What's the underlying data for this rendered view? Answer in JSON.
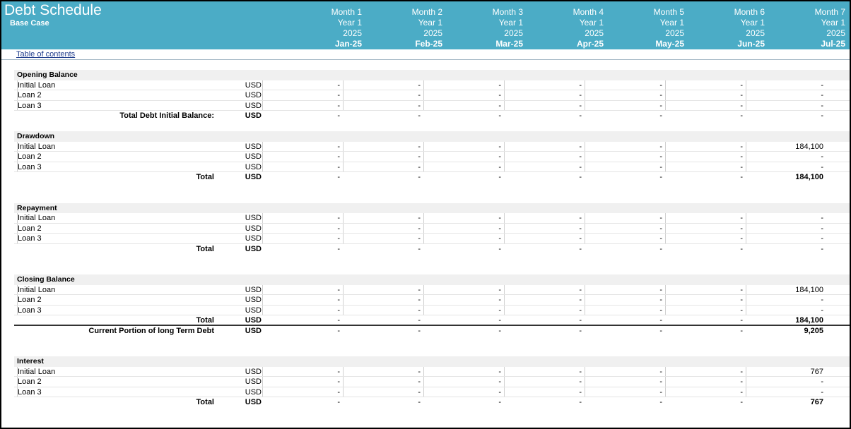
{
  "header": {
    "title": "Debt Schedule",
    "subtitle": "Base Case",
    "columns": [
      {
        "month": "Month 1",
        "year": "Year 1",
        "fy": "2025",
        "date": "Jan-25"
      },
      {
        "month": "Month 2",
        "year": "Year 1",
        "fy": "2025",
        "date": "Feb-25"
      },
      {
        "month": "Month 3",
        "year": "Year 1",
        "fy": "2025",
        "date": "Mar-25"
      },
      {
        "month": "Month 4",
        "year": "Year 1",
        "fy": "2025",
        "date": "Apr-25"
      },
      {
        "month": "Month 5",
        "year": "Year 1",
        "fy": "2025",
        "date": "May-25"
      },
      {
        "month": "Month 6",
        "year": "Year 1",
        "fy": "2025",
        "date": "Jun-25"
      },
      {
        "month": "Month 7",
        "year": "Year 1",
        "fy": "2025",
        "date": "Jul-25"
      }
    ]
  },
  "toc_link": "Table of contents",
  "sections": {
    "opening": {
      "title": "Opening Balance",
      "rows": [
        {
          "label": "Initial Loan",
          "unit": "USD",
          "values": [
            "-",
            "-",
            "-",
            "-",
            "-",
            "-",
            "-"
          ]
        },
        {
          "label": "Loan 2",
          "unit": "USD",
          "values": [
            "-",
            "-",
            "-",
            "-",
            "-",
            "-",
            "-"
          ]
        },
        {
          "label": "Loan 3",
          "unit": "USD",
          "values": [
            "-",
            "-",
            "-",
            "-",
            "-",
            "-",
            "-"
          ]
        }
      ],
      "total": {
        "label": "Total Debt Initial Balance:",
        "unit": "USD",
        "values": [
          "-",
          "-",
          "-",
          "-",
          "-",
          "-",
          "-"
        ]
      }
    },
    "drawdown": {
      "title": "Drawdown",
      "rows": [
        {
          "label": "Initial Loan",
          "unit": "USD",
          "values": [
            "-",
            "-",
            "-",
            "-",
            "-",
            "-",
            "184,100"
          ]
        },
        {
          "label": "Loan 2",
          "unit": "USD",
          "values": [
            "-",
            "-",
            "-",
            "-",
            "-",
            "-",
            "-"
          ]
        },
        {
          "label": "Loan 3",
          "unit": "USD",
          "values": [
            "-",
            "-",
            "-",
            "-",
            "-",
            "-",
            "-"
          ]
        }
      ],
      "total": {
        "label": "Total",
        "unit": "USD",
        "values": [
          "-",
          "-",
          "-",
          "-",
          "-",
          "-",
          "184,100"
        ]
      }
    },
    "repayment": {
      "title": "Repayment",
      "rows": [
        {
          "label": "Initial Loan",
          "unit": "USD",
          "values": [
            "-",
            "-",
            "-",
            "-",
            "-",
            "-",
            "-"
          ]
        },
        {
          "label": "Loan 2",
          "unit": "USD",
          "values": [
            "-",
            "-",
            "-",
            "-",
            "-",
            "-",
            "-"
          ]
        },
        {
          "label": "Loan 3",
          "unit": "USD",
          "values": [
            "-",
            "-",
            "-",
            "-",
            "-",
            "-",
            "-"
          ]
        }
      ],
      "total": {
        "label": "Total",
        "unit": "USD",
        "values": [
          "-",
          "-",
          "-",
          "-",
          "-",
          "-",
          "-"
        ]
      }
    },
    "closing": {
      "title": "Closing Balance",
      "rows": [
        {
          "label": "Initial Loan",
          "unit": "USD",
          "values": [
            "-",
            "-",
            "-",
            "-",
            "-",
            "-",
            "184,100"
          ]
        },
        {
          "label": "Loan 2",
          "unit": "USD",
          "values": [
            "-",
            "-",
            "-",
            "-",
            "-",
            "-",
            "-"
          ]
        },
        {
          "label": "Loan 3",
          "unit": "USD",
          "values": [
            "-",
            "-",
            "-",
            "-",
            "-",
            "-",
            "-"
          ]
        }
      ],
      "total": {
        "label": "Total",
        "unit": "USD",
        "values": [
          "-",
          "-",
          "-",
          "-",
          "-",
          "-",
          "184,100"
        ]
      },
      "current_portion": {
        "label": "Current Portion of long Term Debt",
        "unit": "USD",
        "values": [
          "-",
          "-",
          "-",
          "-",
          "-",
          "-",
          "9,205"
        ]
      }
    },
    "interest": {
      "title": "Interest",
      "rows": [
        {
          "label": "Initial Loan",
          "unit": "USD",
          "values": [
            "-",
            "-",
            "-",
            "-",
            "-",
            "-",
            "767"
          ]
        },
        {
          "label": "Loan 2",
          "unit": "USD",
          "values": [
            "-",
            "-",
            "-",
            "-",
            "-",
            "-",
            "-"
          ]
        },
        {
          "label": "Loan 3",
          "unit": "USD",
          "values": [
            "-",
            "-",
            "-",
            "-",
            "-",
            "-",
            "-"
          ]
        }
      ],
      "total": {
        "label": "Total",
        "unit": "USD",
        "values": [
          "-",
          "-",
          "-",
          "-",
          "-",
          "-",
          "767"
        ]
      }
    }
  }
}
